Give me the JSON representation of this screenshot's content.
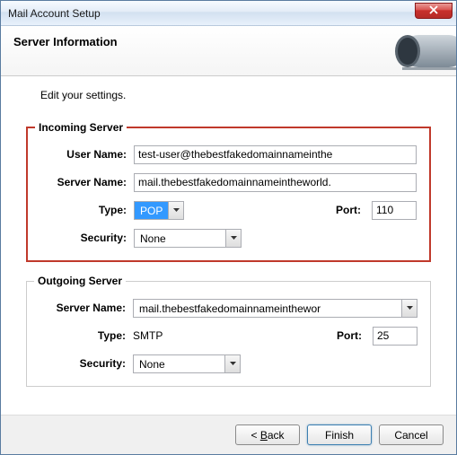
{
  "window": {
    "title": "Mail Account Setup"
  },
  "header": {
    "heading": "Server Information"
  },
  "instruction": "Edit your settings.",
  "incoming": {
    "legend": "Incoming Server",
    "userNameLabel": "User Name:",
    "userNameValue": "test-user@thebestfakedomainnameinthe",
    "serverNameLabel": "Server Name:",
    "serverNameValue": "mail.thebestfakedomainnameintheworld.",
    "typeLabel": "Type:",
    "typeValue": "POP",
    "portLabel": "Port:",
    "portValue": "110",
    "securityLabel": "Security:",
    "securityValue": "None"
  },
  "outgoing": {
    "legend": "Outgoing Server",
    "serverNameLabel": "Server Name:",
    "serverNameValue": "mail.thebestfakedomainnameinthewor",
    "typeLabel": "Type:",
    "typeValue": "SMTP",
    "portLabel": "Port:",
    "portValue": "25",
    "securityLabel": "Security:",
    "securityValue": "None"
  },
  "footer": {
    "back": "< Back",
    "finish": "Finish",
    "cancel": "Cancel"
  }
}
